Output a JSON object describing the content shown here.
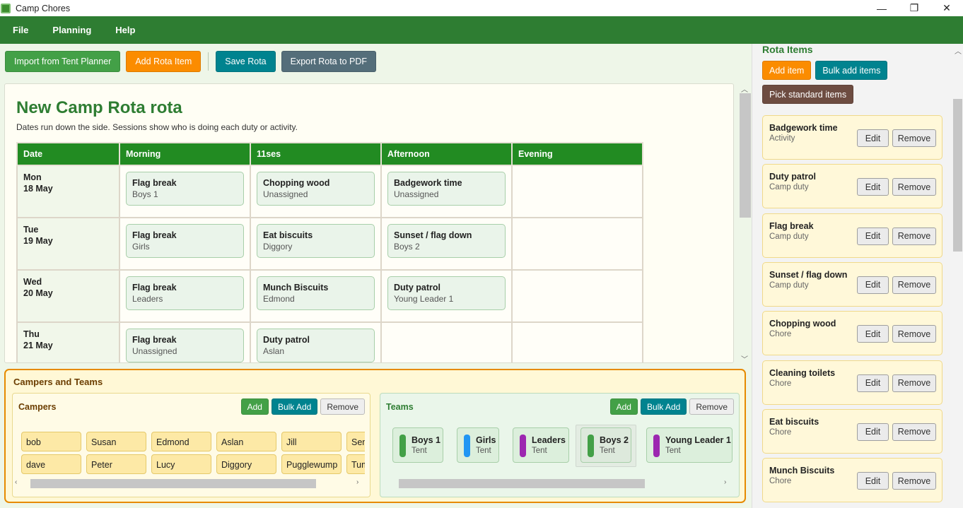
{
  "window": {
    "title": "Camp Chores",
    "controls": [
      "—",
      "❐",
      "✕"
    ]
  },
  "menu": [
    "File",
    "Planning",
    "Help"
  ],
  "toolbar": {
    "import": "Import from Tent Planner",
    "add_rota_item": "Add Rota Item",
    "save": "Save Rota",
    "export": "Export Rota to PDF"
  },
  "rota": {
    "title": "New Camp Rota rota",
    "subtitle": "Dates run down the side. Sessions show who is doing each duty or activity.",
    "headers": [
      "Date",
      "Morning",
      "11ses",
      "Afternoon",
      "Evening"
    ],
    "rows": [
      {
        "day": "Mon",
        "date": "18 May",
        "slots": [
          {
            "title": "Flag break",
            "who": "Boys 1"
          },
          {
            "title": "Chopping wood",
            "who": "Unassigned"
          },
          {
            "title": "Badgework time",
            "who": "Unassigned"
          },
          null
        ]
      },
      {
        "day": "Tue",
        "date": "19 May",
        "slots": [
          {
            "title": "Flag break",
            "who": "Girls"
          },
          {
            "title": "Eat biscuits",
            "who": "Diggory"
          },
          {
            "title": "Sunset / flag down",
            "who": "Boys 2"
          },
          null
        ]
      },
      {
        "day": "Wed",
        "date": "20 May",
        "slots": [
          {
            "title": "Flag break",
            "who": "Leaders"
          },
          {
            "title": "Munch Biscuits",
            "who": "Edmond"
          },
          {
            "title": "Duty patrol",
            "who": "Young Leader 1"
          },
          null
        ]
      },
      {
        "day": "Thu",
        "date": "21 May",
        "slots": [
          {
            "title": "Flag break",
            "who": "Unassigned"
          },
          {
            "title": "Duty patrol",
            "who": "Aslan"
          },
          null,
          null
        ]
      }
    ]
  },
  "campers_teams": {
    "title": "Campers and Teams",
    "campers": {
      "title": "Campers",
      "add": "Add",
      "bulk_add": "Bulk Add",
      "remove": "Remove",
      "names": [
        "bob",
        "Susan",
        "Edmond",
        "Aslan",
        "Jill",
        "Sen",
        "dave",
        "Peter",
        "Lucy",
        "Diggory",
        "Pugglewump",
        "Tum"
      ]
    },
    "teams": {
      "title": "Teams",
      "add": "Add",
      "bulk_add": "Bulk Add",
      "remove": "Remove",
      "list": [
        {
          "name": "Boys 1",
          "type": "Tent",
          "color": "#43a047"
        },
        {
          "name": "Girls",
          "type": "Tent",
          "color": "#2196f3"
        },
        {
          "name": "Leaders",
          "type": "Tent",
          "color": "#9c27b0"
        },
        {
          "name": "Boys 2",
          "type": "Tent",
          "color": "#43a047"
        },
        {
          "name": "Young Leader 1",
          "type": "Tent",
          "color": "#9c27b0"
        }
      ]
    }
  },
  "rota_items": {
    "title": "Rota Items",
    "add_item": "Add item",
    "bulk_add": "Bulk add items",
    "pick_standard": "Pick standard items",
    "edit": "Edit",
    "remove": "Remove",
    "items": [
      {
        "name": "Badgework time",
        "category": "Activity"
      },
      {
        "name": "Duty patrol",
        "category": "Camp duty"
      },
      {
        "name": "Flag break",
        "category": "Camp duty"
      },
      {
        "name": "Sunset / flag down",
        "category": "Camp duty"
      },
      {
        "name": "Chopping wood",
        "category": "Chore"
      },
      {
        "name": "Cleaning toilets",
        "category": "Chore"
      },
      {
        "name": "Eat biscuits",
        "category": "Chore"
      },
      {
        "name": "Munch Biscuits",
        "category": "Chore"
      }
    ]
  },
  "colors": {
    "brand": "#2e7d32",
    "header": "#228b22",
    "accent_orange": "#fb8c00",
    "teal": "#00838f"
  }
}
